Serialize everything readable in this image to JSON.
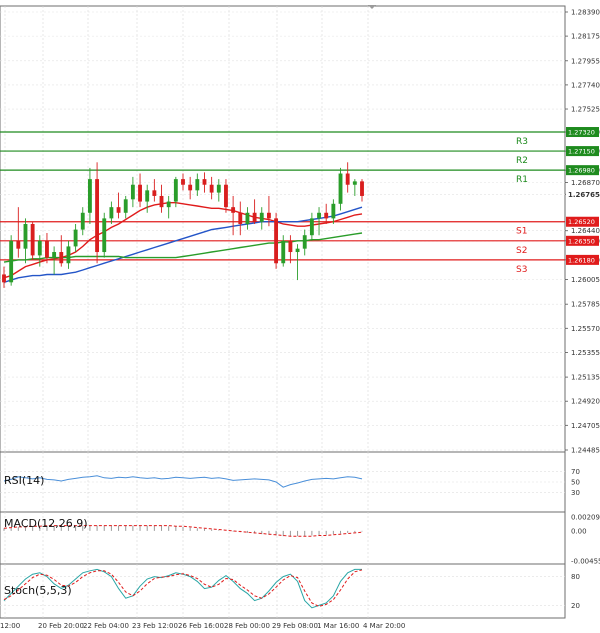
{
  "chart_data": [
    {
      "type": "candlestick",
      "pane": "price",
      "ylim": [
        1.24485,
        1.2839
      ],
      "y_ticks": [
        "1.28390",
        "1.28175",
        "1.27955",
        "1.27740",
        "1.27525",
        "1.27320",
        "1.27150",
        "1.26980",
        "1.26870",
        "1.26765",
        "1.26440",
        "1.26350",
        "1.26180",
        "1.26005",
        "1.25785",
        "1.25570",
        "1.25355",
        "1.25135",
        "1.24920",
        "1.24705",
        "1.24485"
      ],
      "x_ticks": [
        "12:00",
        "20 Feb 20:00",
        "22 Feb 04:00",
        "23 Feb 12:00",
        "26 Feb 16:00",
        "28 Feb 00:00",
        "29 Feb 08:00",
        "1 Mar 16:00",
        "4 Mar 20:00"
      ],
      "levels": [
        {
          "label": "R3",
          "value": 1.2732,
          "tag": "1.27320",
          "color": "#1e8b1e"
        },
        {
          "label": "R2",
          "value": 1.2715,
          "tag": "1.27150",
          "color": "#1e8b1e"
        },
        {
          "label": "R1",
          "value": 1.2698,
          "tag": "1.26980",
          "color": "#1e8b1e"
        },
        {
          "label": "S1",
          "value": 1.2652,
          "tag": "1.26520",
          "color": "#e01b1b"
        },
        {
          "label": "S2",
          "value": 1.2635,
          "tag": "1.26350",
          "color": "#e01b1b"
        },
        {
          "label": "S3",
          "value": 1.2618,
          "tag": "1.26180",
          "color": "#e01b1b"
        }
      ],
      "last_price": "1.26765",
      "candles": [
        [
          1.2605,
          1.2612,
          1.2593,
          1.2598
        ],
        [
          1.2598,
          1.264,
          1.2595,
          1.2635
        ],
        [
          1.2635,
          1.2665,
          1.262,
          1.2628
        ],
        [
          1.2628,
          1.2655,
          1.2615,
          1.265
        ],
        [
          1.265,
          1.2652,
          1.2618,
          1.2622
        ],
        [
          1.2622,
          1.264,
          1.2612,
          1.2635
        ],
        [
          1.2635,
          1.2642,
          1.2615,
          1.262
        ],
        [
          1.262,
          1.263,
          1.2605,
          1.2625
        ],
        [
          1.2625,
          1.264,
          1.2612,
          1.2615
        ],
        [
          1.2615,
          1.2635,
          1.261,
          1.263
        ],
        [
          1.263,
          1.265,
          1.2625,
          1.2645
        ],
        [
          1.2645,
          1.2665,
          1.264,
          1.266
        ],
        [
          1.266,
          1.27,
          1.265,
          1.269
        ],
        [
          1.269,
          1.2705,
          1.2615,
          1.2625
        ],
        [
          1.2625,
          1.266,
          1.262,
          1.2655
        ],
        [
          1.2655,
          1.267,
          1.265,
          1.2665
        ],
        [
          1.2665,
          1.2678,
          1.2655,
          1.266
        ],
        [
          1.266,
          1.2675,
          1.2655,
          1.2672
        ],
        [
          1.2672,
          1.2692,
          1.2665,
          1.2685
        ],
        [
          1.2685,
          1.2695,
          1.2665,
          1.267
        ],
        [
          1.267,
          1.2685,
          1.266,
          1.268
        ],
        [
          1.268,
          1.269,
          1.267,
          1.2675
        ],
        [
          1.2675,
          1.2685,
          1.266,
          1.2665
        ],
        [
          1.2665,
          1.2675,
          1.2655,
          1.267
        ],
        [
          1.267,
          1.2692,
          1.2665,
          1.269
        ],
        [
          1.269,
          1.2695,
          1.268,
          1.2685
        ],
        [
          1.2685,
          1.2692,
          1.2672,
          1.268
        ],
        [
          1.268,
          1.2695,
          1.2675,
          1.269
        ],
        [
          1.269,
          1.2696,
          1.2678,
          1.2685
        ],
        [
          1.2685,
          1.2692,
          1.2672,
          1.2678
        ],
        [
          1.2678,
          1.269,
          1.267,
          1.2685
        ],
        [
          1.2685,
          1.269,
          1.266,
          1.2665
        ],
        [
          1.2665,
          1.2675,
          1.264,
          1.266
        ],
        [
          1.266,
          1.267,
          1.264,
          1.265
        ],
        [
          1.265,
          1.2665,
          1.2645,
          1.266
        ],
        [
          1.266,
          1.2672,
          1.265,
          1.2652
        ],
        [
          1.2652,
          1.2665,
          1.2645,
          1.266
        ],
        [
          1.266,
          1.2675,
          1.2648,
          1.2655
        ],
        [
          1.2655,
          1.266,
          1.261,
          1.2615
        ],
        [
          1.2615,
          1.264,
          1.2612,
          1.2635
        ],
        [
          1.2635,
          1.264,
          1.2615,
          1.2625
        ],
        [
          1.2625,
          1.2632,
          1.26,
          1.2628
        ],
        [
          1.2628,
          1.2645,
          1.2622,
          1.264
        ],
        [
          1.264,
          1.266,
          1.2635,
          1.2655
        ],
        [
          1.2655,
          1.2665,
          1.264,
          1.266
        ],
        [
          1.266,
          1.2668,
          1.265,
          1.2655
        ],
        [
          1.2655,
          1.2672,
          1.265,
          1.2668
        ],
        [
          1.2668,
          1.27,
          1.2662,
          1.2695
        ],
        [
          1.2695,
          1.2705,
          1.2678,
          1.2685
        ],
        [
          1.2685,
          1.269,
          1.2675,
          1.2688
        ],
        [
          1.2688,
          1.269,
          1.267,
          1.2675
        ]
      ],
      "series": [
        {
          "name": "",
          "color": "#e01b1b",
          "values": [
            1.2602,
            1.2604,
            1.2608,
            1.2612,
            1.2614,
            1.2616,
            1.2618,
            1.2619,
            1.262,
            1.2622,
            1.2625,
            1.263,
            1.2636,
            1.264,
            1.2643,
            1.2647,
            1.265,
            1.2654,
            1.2658,
            1.2662,
            1.2665,
            1.2667,
            1.2668,
            1.2669,
            1.2669,
            1.2668,
            1.2667,
            1.2666,
            1.2665,
            1.2664,
            1.2664,
            1.2663,
            1.2662,
            1.266,
            1.2658,
            1.2656,
            1.2655,
            1.2654,
            1.2652,
            1.265,
            1.2649,
            1.2648,
            1.2648,
            1.2649,
            1.265,
            1.2651,
            1.2652,
            1.2654,
            1.2656,
            1.2658,
            1.2659
          ]
        },
        {
          "name": "",
          "color": "#2455c8",
          "values": [
            1.2598,
            1.26,
            1.2602,
            1.2603,
            1.2604,
            1.2604,
            1.2605,
            1.2605,
            1.2605,
            1.2606,
            1.2607,
            1.2609,
            1.2611,
            1.2613,
            1.2615,
            1.2617,
            1.2619,
            1.2621,
            1.2623,
            1.2625,
            1.2627,
            1.2629,
            1.2631,
            1.2633,
            1.2635,
            1.2637,
            1.2639,
            1.2641,
            1.2643,
            1.2645,
            1.2646,
            1.2647,
            1.2648,
            1.2649,
            1.265,
            1.2651,
            1.2652,
            1.2652,
            1.2652,
            1.2652,
            1.2652,
            1.2652,
            1.2653,
            1.2654,
            1.2655,
            1.2656,
            1.2657,
            1.2659,
            1.2661,
            1.2663,
            1.2665
          ]
        },
        {
          "name": "",
          "color": "#2a9d2a",
          "values": [
            1.2616,
            1.2617,
            1.2618,
            1.2618,
            1.2619,
            1.2619,
            1.262,
            1.262,
            1.262,
            1.262,
            1.2621,
            1.2621,
            1.2621,
            1.2621,
            1.2621,
            1.2621,
            1.2621,
            1.262,
            1.262,
            1.262,
            1.262,
            1.262,
            1.262,
            1.262,
            1.262,
            1.2621,
            1.2622,
            1.2623,
            1.2624,
            1.2625,
            1.2626,
            1.2627,
            1.2628,
            1.2629,
            1.263,
            1.2631,
            1.2632,
            1.2633,
            1.2633,
            1.2634,
            1.2634,
            1.2635,
            1.2635,
            1.2636,
            1.2636,
            1.2637,
            1.2638,
            1.2639,
            1.264,
            1.2641,
            1.2642
          ]
        }
      ]
    },
    {
      "type": "line",
      "pane": "rsi",
      "title": "RSI(14)",
      "ylim": [
        0,
        100
      ],
      "y_ticks": [
        "70",
        "50",
        "30"
      ],
      "series": [
        {
          "name": "",
          "color": "#4a8fd9",
          "values": [
            52,
            55,
            60,
            58,
            56,
            58,
            55,
            54,
            52,
            55,
            57,
            59,
            60,
            62,
            58,
            57,
            59,
            58,
            60,
            58,
            57,
            58,
            56,
            57,
            59,
            58,
            57,
            58,
            59,
            57,
            58,
            56,
            53,
            54,
            55,
            56,
            55,
            54,
            50,
            40,
            45,
            48,
            52,
            55,
            56,
            57,
            56,
            58,
            60,
            59,
            56
          ]
        }
      ]
    },
    {
      "type": "bar",
      "pane": "macd",
      "title": "MACD(12,26,9)",
      "y_ticks": [
        "0.002097",
        "0.00",
        "-0.004555"
      ],
      "ylim": [
        -0.004555,
        0.002097
      ],
      "series": [
        {
          "name": "",
          "color": "#999999",
          "values": [
            0.0004,
            0.0005,
            0.0006,
            0.0006,
            0.0007,
            0.0007,
            0.0008,
            0.0008,
            0.0008,
            0.0008,
            0.0008,
            0.0008,
            0.0008,
            0.0008,
            0.0008,
            0.0008,
            0.0008,
            0.0008,
            0.0008,
            0.0008,
            0.0008,
            0.0008,
            0.0008,
            0.0007,
            0.0007,
            0.0006,
            0.0005,
            0.0004,
            0.0003,
            0.0002,
            0.0001,
            0.0,
            -0.0001,
            -0.0002,
            -0.0003,
            -0.0004,
            -0.0005,
            -0.0006,
            -0.0007,
            -0.0008,
            -0.0008,
            -0.0008,
            -0.0008,
            -0.0007,
            -0.0007,
            -0.0006,
            -0.0005,
            -0.0004,
            -0.0003,
            -0.0002,
            -0.0001
          ]
        },
        {
          "name": "",
          "color": "#e01b1b",
          "values": [
            0.0004,
            0.0005,
            0.0006,
            0.0006,
            0.0007,
            0.0007,
            0.0008,
            0.0008,
            0.0008,
            0.0008,
            0.0008,
            0.0008,
            0.0008,
            0.0008,
            0.0008,
            0.0008,
            0.0008,
            0.0008,
            0.0008,
            0.0008,
            0.0008,
            0.0008,
            0.0008,
            0.0008,
            0.0007,
            0.0007,
            0.0006,
            0.0005,
            0.0004,
            0.0003,
            0.0002,
            0.0001,
            0.0,
            -0.0001,
            -0.0002,
            -0.0003,
            -0.0004,
            -0.0005,
            -0.0006,
            -0.0007,
            -0.0008,
            -0.0008,
            -0.0008,
            -0.0008,
            -0.0007,
            -0.0007,
            -0.0006,
            -0.0005,
            -0.0004,
            -0.0003,
            -0.0002
          ]
        }
      ]
    },
    {
      "type": "line",
      "pane": "stoch",
      "title": "Stoch(5,5,3)",
      "ylim": [
        0,
        100
      ],
      "y_ticks": [
        "80",
        "20"
      ],
      "series": [
        {
          "name": "",
          "color": "#2aa6a6",
          "values": [
            30,
            45,
            60,
            75,
            85,
            88,
            80,
            65,
            55,
            62,
            75,
            88,
            92,
            95,
            90,
            80,
            55,
            35,
            40,
            60,
            75,
            80,
            78,
            82,
            88,
            85,
            80,
            70,
            55,
            58,
            72,
            82,
            70,
            55,
            45,
            30,
            35,
            50,
            68,
            80,
            85,
            70,
            30,
            15,
            20,
            25,
            40,
            70,
            88,
            95,
            95
          ]
        },
        {
          "name": "",
          "color": "#e01b1b",
          "values": [
            32,
            40,
            52,
            65,
            78,
            85,
            83,
            74,
            62,
            60,
            68,
            80,
            88,
            92,
            92,
            85,
            68,
            48,
            40,
            50,
            65,
            76,
            79,
            80,
            84,
            86,
            82,
            76,
            64,
            58,
            64,
            76,
            74,
            62,
            52,
            40,
            35,
            44,
            58,
            73,
            82,
            78,
            50,
            25,
            18,
            22,
            32,
            52,
            75,
            90,
            94
          ]
        }
      ]
    }
  ]
}
